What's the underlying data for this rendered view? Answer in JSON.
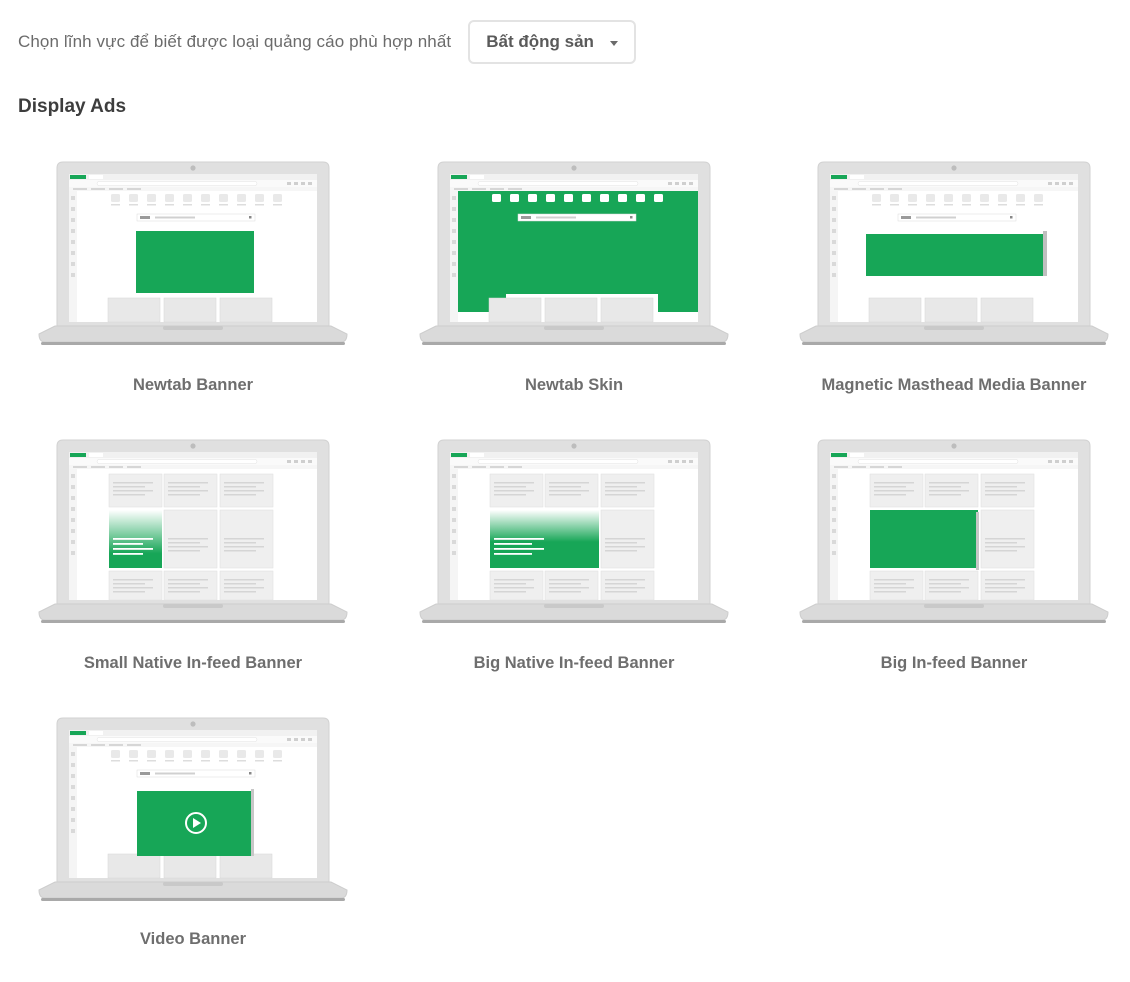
{
  "filter": {
    "label": "Chọn lĩnh vực để biết được loại quảng cáo phù hợp nhất",
    "selected": "Bất động sản"
  },
  "section": {
    "title": "Display Ads"
  },
  "colors": {
    "accent_green": "#17a657",
    "frame_gray": "#dcdcdc",
    "text_gray": "#6e6e6e"
  },
  "cards": [
    {
      "title": "Newtab Banner",
      "variant": "newtab-banner"
    },
    {
      "title": "Newtab Skin",
      "variant": "newtab-skin"
    },
    {
      "title": "Magnetic Masthead Media Banner",
      "variant": "masthead"
    },
    {
      "title": "Small Native In-feed Banner",
      "variant": "small-native"
    },
    {
      "title": "Big Native In-feed Banner",
      "variant": "big-native"
    },
    {
      "title": "Big In-feed Banner",
      "variant": "big-infeed"
    },
    {
      "title": "Video Banner",
      "variant": "video"
    }
  ]
}
